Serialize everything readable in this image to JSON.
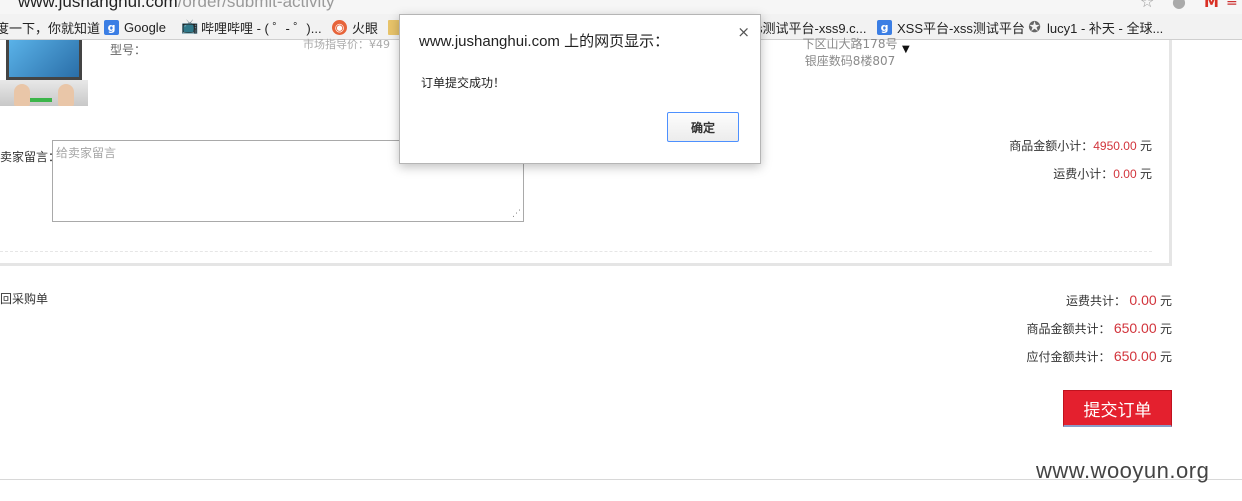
{
  "browser": {
    "url_host": "www.jushanghui.com",
    "url_path": "/order/submit-activity",
    "bookmarks": [
      {
        "label": "度一下，你就知道",
        "icon": "paw-icon"
      },
      {
        "label": "Google",
        "icon": "google-icon"
      },
      {
        "label": "哔哩哔哩 - ( ゜- ゜)...",
        "icon": "tv-icon"
      },
      {
        "label": "火眼",
        "icon": "fire-icon"
      },
      {
        "label": "s测试平台-xss9.c...",
        "icon": "folder-icon"
      },
      {
        "label": "XSS平台-xss测试平台",
        "icon": "google-icon"
      },
      {
        "label": "lucy1 - 补天 - 全球...",
        "icon": "star-icon"
      }
    ]
  },
  "order": {
    "model_label": "型号：",
    "price_hint": "市场指导价：¥49",
    "address": "下区山大路178号银座数码8楼807",
    "message_label": "卖家留言：",
    "message_placeholder": "给卖家留言",
    "goods_subtotal_label": "商品金额小计：",
    "goods_subtotal_value": "4950.00",
    "shipping_subtotal_label": "运费小计：",
    "shipping_subtotal_value": "0.00",
    "currency": "元"
  },
  "summary": {
    "back_link": "回采购单",
    "shipping_total_label": "运费共计：",
    "shipping_total_value": "0.00",
    "goods_total_label": "商品金额共计：",
    "goods_total_value": "650.00",
    "payable_total_label": "应付金额共计：",
    "payable_total_value": "650.00",
    "currency": "元",
    "submit_label": "提交订单"
  },
  "dialog": {
    "title": "www.jushanghui.com 上的网页显示：",
    "message": "订单提交成功！",
    "ok_label": "确定",
    "close_symbol": "×"
  },
  "watermark": "www.wooyun.org",
  "colors": {
    "price_red": "#d2343c",
    "button_red": "#e4202e",
    "focus_blue": "#4d90fe"
  }
}
